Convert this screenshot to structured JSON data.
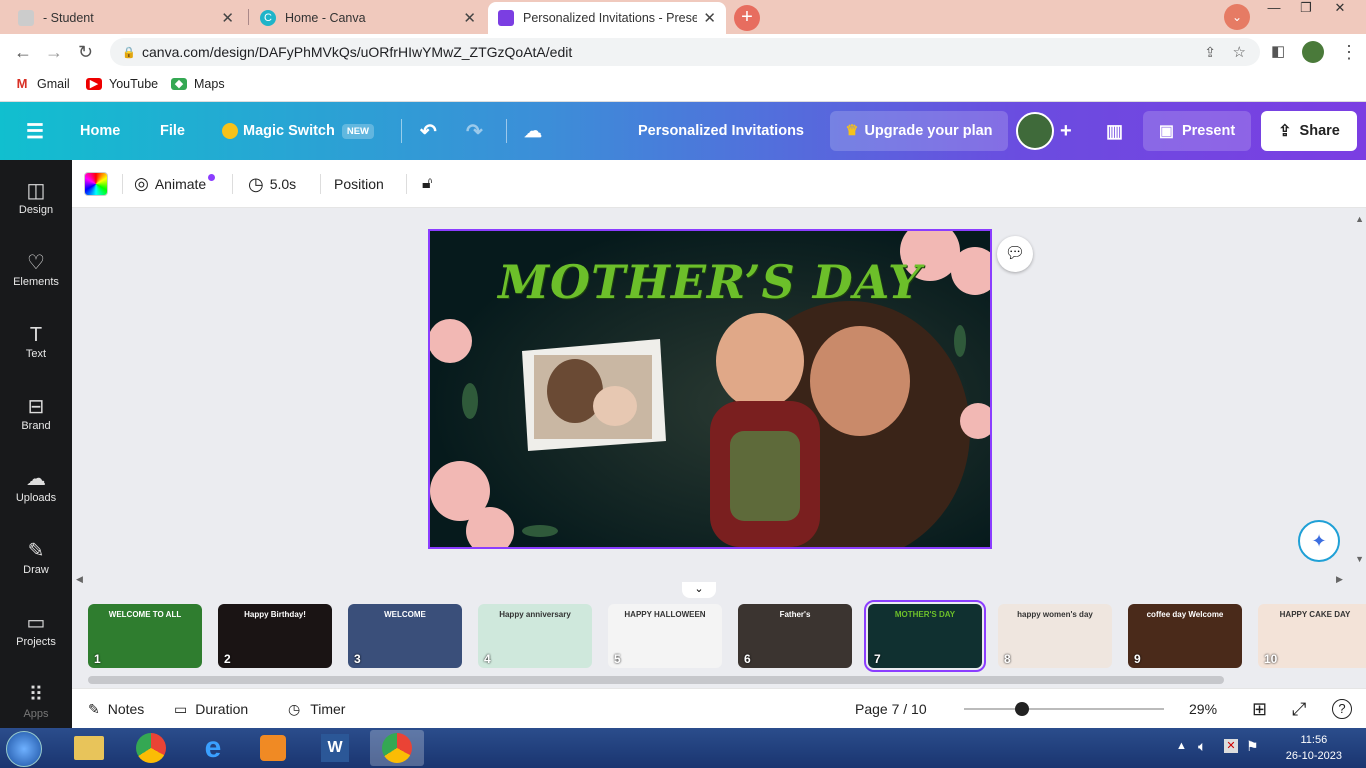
{
  "browser": {
    "tabs": [
      {
        "title": "- Student"
      },
      {
        "title": "Home - Canva"
      },
      {
        "title": "Personalized Invitations - Present"
      }
    ],
    "url": "canva.com/design/DAFyPhMVkQs/uORfrHIwYMwZ_ZTGzQoAtA/edit",
    "bookmarks": [
      {
        "label": "Gmail"
      },
      {
        "label": "YouTube"
      },
      {
        "label": "Maps"
      }
    ]
  },
  "header": {
    "home": "Home",
    "file": "File",
    "magic_switch": "Magic Switch",
    "new_badge": "NEW",
    "doc_title": "Personalized Invitations",
    "upgrade": "Upgrade your plan",
    "present": "Present",
    "share": "Share"
  },
  "sidebar": {
    "items": [
      {
        "label": "Design"
      },
      {
        "label": "Elements"
      },
      {
        "label": "Text"
      },
      {
        "label": "Brand"
      },
      {
        "label": "Uploads"
      },
      {
        "label": "Draw"
      },
      {
        "label": "Projects"
      },
      {
        "label": "Apps"
      }
    ]
  },
  "toolbar": {
    "animate": "Animate",
    "duration": "5.0s",
    "position": "Position"
  },
  "slide": {
    "title": "MOTHER’S DAY"
  },
  "filmstrip": {
    "pages": [
      {
        "num": "1",
        "text": "WELCOME TO ALL",
        "bg": "#2f7d2f"
      },
      {
        "num": "2",
        "text": "Happy Birthday!",
        "bg": "#1a1414"
      },
      {
        "num": "3",
        "text": "WELCOME",
        "bg": "#3a4f7a"
      },
      {
        "num": "4",
        "text": "Happy anniversary",
        "bg": "#cfe8dc"
      },
      {
        "num": "5",
        "text": "HAPPY HALLOWEEN",
        "bg": "#f4f4f4"
      },
      {
        "num": "6",
        "text": "Father's",
        "bg": "#3b3430"
      },
      {
        "num": "7",
        "text": "MOTHER'S DAY",
        "bg": "#103030"
      },
      {
        "num": "8",
        "text": "happy women's day",
        "bg": "#efe6df"
      },
      {
        "num": "9",
        "text": "coffee day Welcome",
        "bg": "#4a2a1a"
      },
      {
        "num": "10",
        "text": "HAPPY CAKE DAY",
        "bg": "#f3e3d8"
      }
    ]
  },
  "bottom": {
    "notes": "Notes",
    "duration": "Duration",
    "timer": "Timer",
    "page": "Page 7 / 10",
    "zoom": "29%",
    "zoom_value": 0.29
  },
  "taskbar": {
    "time": "11:56",
    "date": "26-10-2023"
  },
  "colors": {
    "accent": "#8b3dff",
    "sidebar": "#18191b"
  }
}
